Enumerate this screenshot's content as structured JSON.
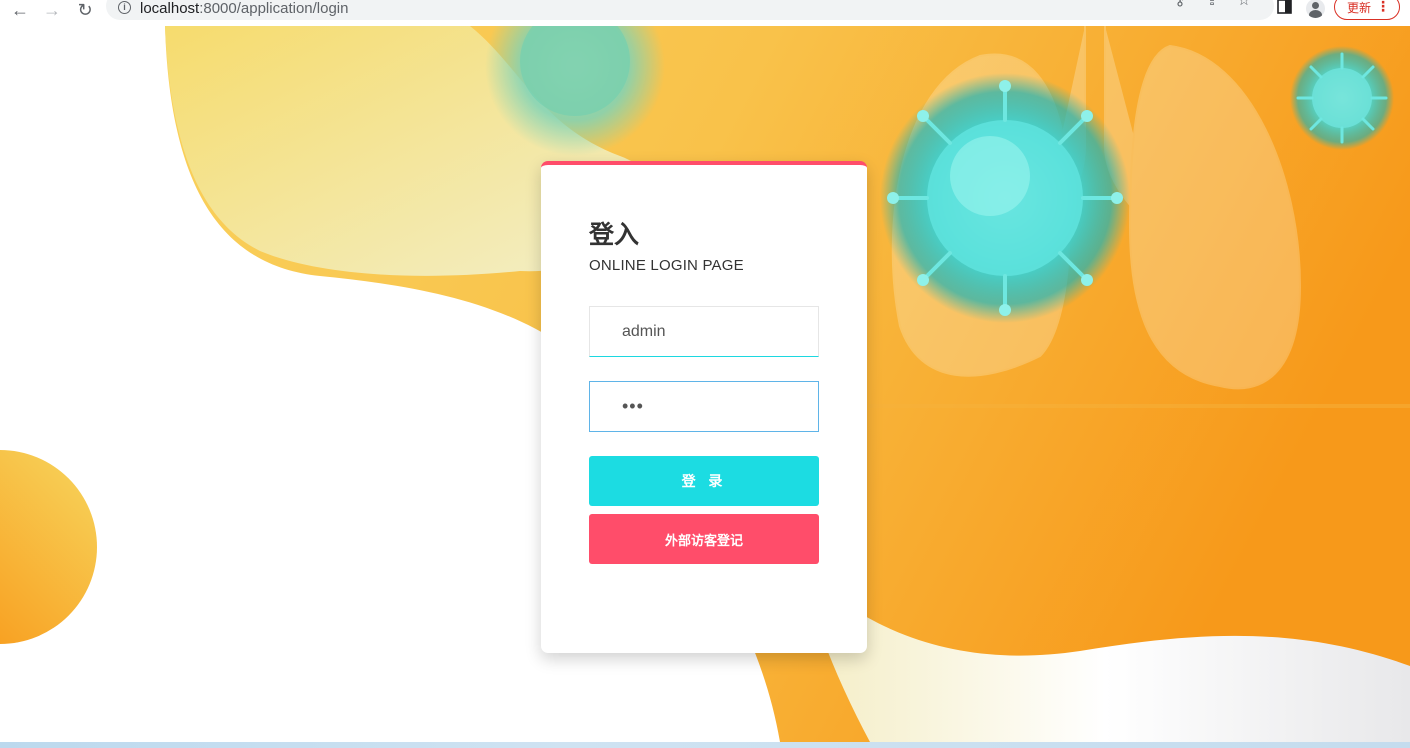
{
  "browser": {
    "url_host": "localhost",
    "url_path": ":8000/application/login",
    "update_label": "更新"
  },
  "login": {
    "title": "登入",
    "subtitle": "ONLINE LOGIN PAGE",
    "username_value": "admin",
    "password_value": "•••",
    "login_button": "登 录",
    "visitor_button": "外部访客登记"
  },
  "colors": {
    "accent_pink": "#ff4d6a",
    "accent_cyan": "#1cdce2",
    "background_orange": "#f7a11c"
  }
}
